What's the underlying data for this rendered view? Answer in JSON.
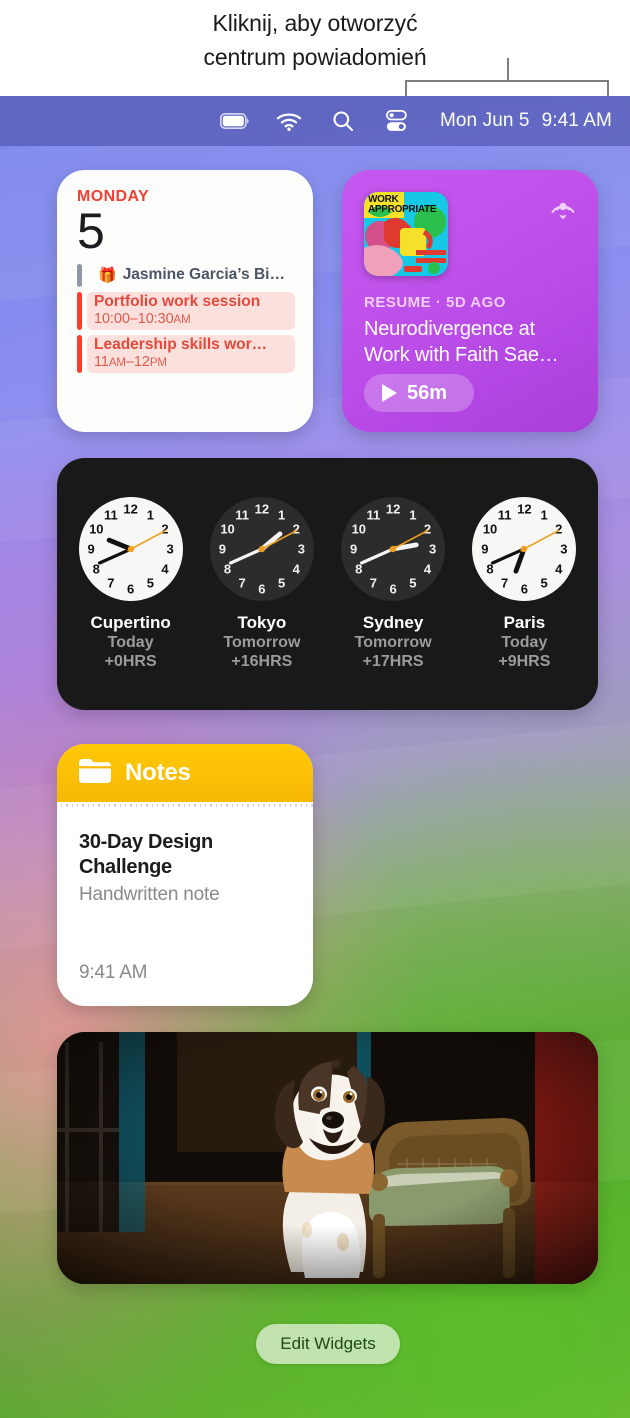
{
  "callout": {
    "line1": "Kliknij, aby otworzyć",
    "line2": "centrum powiadomień"
  },
  "menubar": {
    "icons": [
      "battery-icon",
      "wifi-icon",
      "search-icon",
      "control-center-icon"
    ],
    "date": "Mon Jun 5",
    "time": "9:41 AM"
  },
  "widgets": {
    "calendar": {
      "weekday": "MONDAY",
      "day": "5",
      "events": [
        {
          "title": "Jasmine Garcia’s Bi…",
          "time": "",
          "style": "plain",
          "bar": "grey",
          "icon": "gift-icon"
        },
        {
          "title": "Portfolio work session",
          "time_main": "10:00–10:30",
          "time_suffix": "AM",
          "style": "tint",
          "bar": "red"
        },
        {
          "title": "Leadership skills wor…",
          "time_main": "11",
          "time_suffix_a": "AM",
          "time_mid": "–12",
          "time_suffix_b": "PM",
          "style": "tint",
          "bar": "red"
        }
      ]
    },
    "podcast": {
      "artwork_title": "WORK APPROPRIATE",
      "meta": "RESUME · 5D AGO",
      "title": "Neurodivergence at Work with Faith Sae…",
      "duration": "56m",
      "badge": "podcasts-icon"
    },
    "world_clock": {
      "clocks": [
        {
          "city": "Cupertino",
          "day": "Today",
          "offset": "+0HRS",
          "theme": "light",
          "hour_deg": 292,
          "minute_deg": 246,
          "second_deg": 62
        },
        {
          "city": "Tokyo",
          "day": "Tomorrow",
          "offset": "+16HRS",
          "theme": "dark",
          "hour_deg": 50,
          "minute_deg": 246,
          "second_deg": 62
        },
        {
          "city": "Sydney",
          "day": "Tomorrow",
          "offset": "+17HRS",
          "theme": "dark",
          "hour_deg": 80,
          "minute_deg": 246,
          "second_deg": 62
        },
        {
          "city": "Paris",
          "day": "Today",
          "offset": "+9HRS",
          "theme": "light",
          "hour_deg": 200,
          "minute_deg": 246,
          "second_deg": 62
        }
      ],
      "hour_numerals": [
        "12",
        "1",
        "2",
        "3",
        "4",
        "5",
        "6",
        "7",
        "8",
        "9",
        "10",
        "11"
      ]
    },
    "notes": {
      "app_label": "Notes",
      "folder_icon": "folder-icon",
      "note_title": "30-Day Design Challenge",
      "note_subtitle": "Handwritten note",
      "note_time": "9:41 AM"
    },
    "photo": {
      "alt": "dog-photo"
    }
  },
  "footer": {
    "edit_widgets_label": "Edit Widgets"
  },
  "colors": {
    "calendar_accent": "#ef4136",
    "event_red": "#fc3d2e",
    "event_tint": "#fce0dd",
    "notes_yellow": "#ffc907",
    "podcast_purple": "#c556f0",
    "clock_second_hand": "#f0a020",
    "menubar": "#5b62c4"
  }
}
